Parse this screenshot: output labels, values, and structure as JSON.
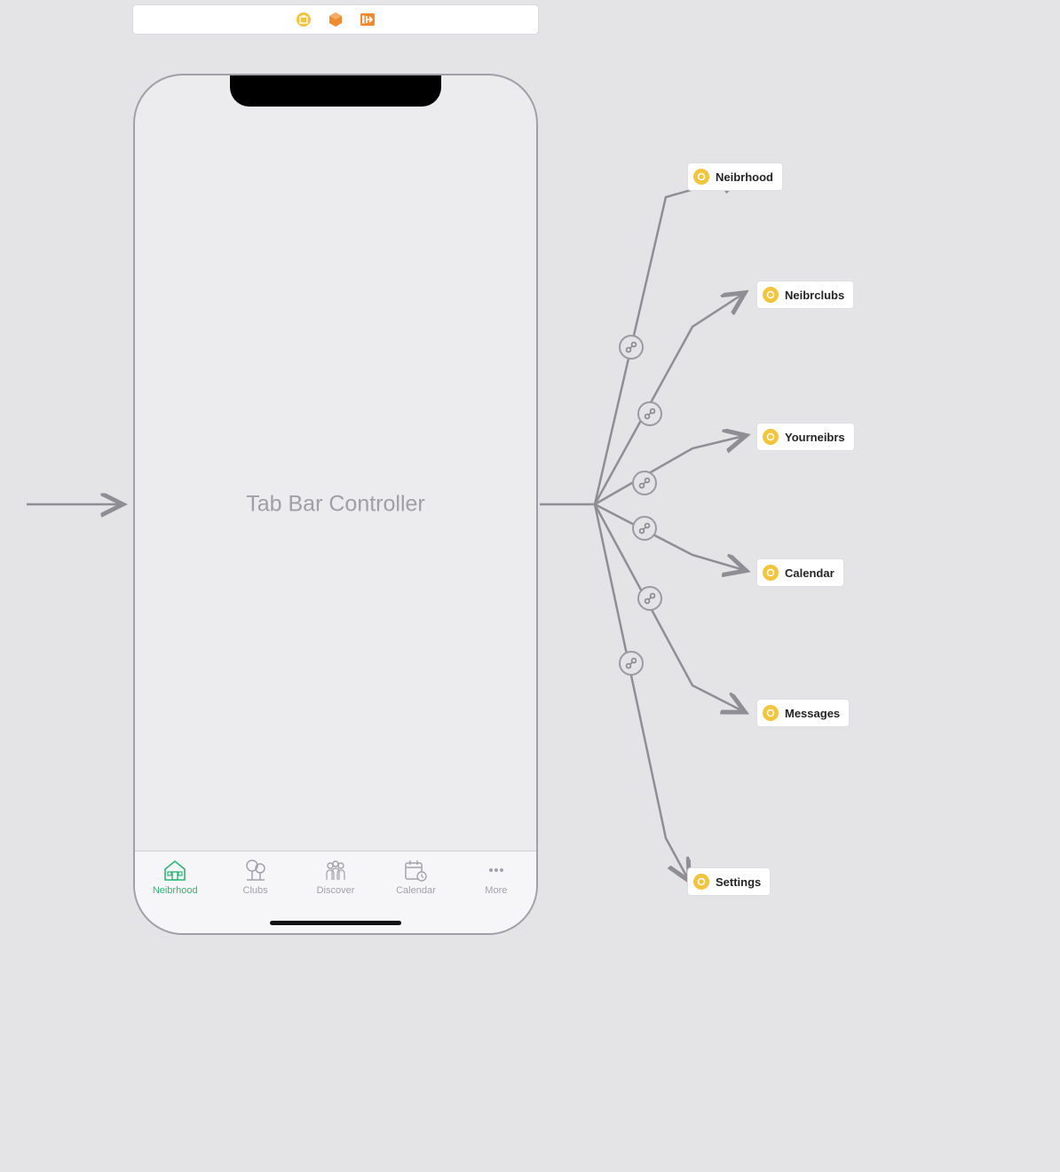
{
  "title": "Tab Bar Controller",
  "tabbar": {
    "items": [
      {
        "label": "Neibrhood",
        "active": true
      },
      {
        "label": "Clubs",
        "active": false
      },
      {
        "label": "Discover",
        "active": false
      },
      {
        "label": "Calendar",
        "active": false
      },
      {
        "label": "More",
        "active": false
      }
    ]
  },
  "destinations": [
    {
      "label": "Neibrhood"
    },
    {
      "label": "Neibrclubs"
    },
    {
      "label": "Yourneibrs"
    },
    {
      "label": "Calendar"
    },
    {
      "label": "Messages"
    },
    {
      "label": "Settings"
    }
  ],
  "colors": {
    "active_tab": "#2bb673",
    "inactive_tab": "#a2a2a8",
    "chip_icon": "#f3c53f",
    "toolbar_icon_orange": "#ef8b2e",
    "toolbar_icon_yellow": "#f3c53f"
  }
}
